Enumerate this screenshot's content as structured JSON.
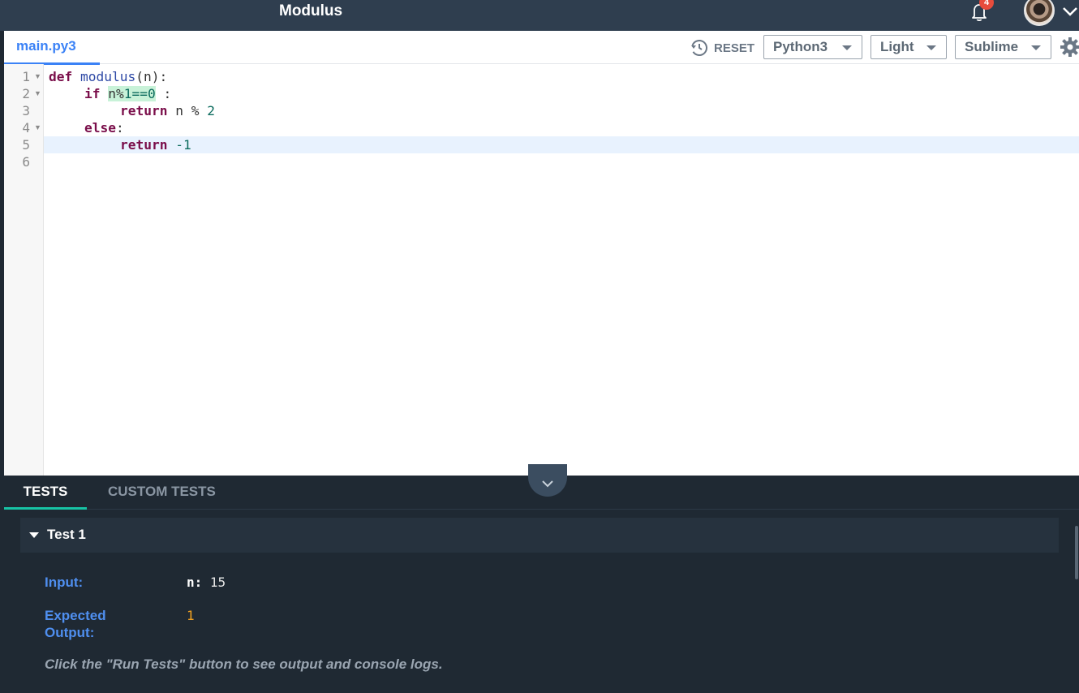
{
  "app": {
    "title": "Modulus",
    "notification_count": "4"
  },
  "editor": {
    "file_tab": "main.py3",
    "reset_label": "RESET",
    "language": "Python3",
    "theme": "Light",
    "keymap": "Sublime",
    "line_numbers": [
      "1",
      "2",
      "3",
      "4",
      "5",
      "6"
    ],
    "active_line": 5,
    "code": {
      "l1_kw": "def",
      "l1_fn": "modulus",
      "l1_rest": "(n):",
      "l2_kw": "if",
      "l2_cond_a": "n%",
      "l2_cond_b": "1==0",
      "l2_rest": " :",
      "l3_kw": "return",
      "l3_rest": " n % ",
      "l3_num": "2",
      "l4_kw": "else",
      "l4_rest": ":",
      "l5_kw": "return",
      "l5_num": "-1"
    }
  },
  "tests": {
    "tabs": [
      "TESTS",
      "CUSTOM TESTS"
    ],
    "active_tab": "TESTS",
    "test_title": "Test 1",
    "input_label": "Input:",
    "input_key": "n:",
    "input_value": "15",
    "expected_label_1": "Expected",
    "expected_label_2": "Output:",
    "expected_value": "1",
    "hint": "Click the \"Run Tests\" button to see output and console logs."
  },
  "colors": {
    "accent_blue": "#3b82f6",
    "teal": "#17c3a5",
    "badge_red": "#e74c3c",
    "expected_orange": "#f0a020"
  },
  "icons": [
    "bell-icon",
    "chevron-down-icon",
    "reset-icon",
    "gear-icon",
    "caret-down-icon"
  ]
}
